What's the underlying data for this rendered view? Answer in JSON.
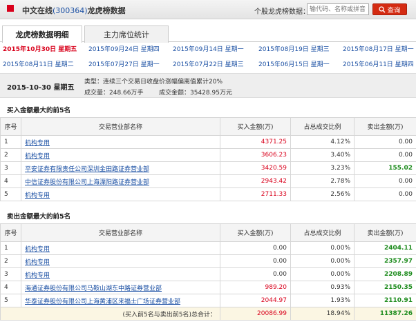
{
  "header": {
    "title_prefix": "中文在线",
    "stock_code": "(300364)",
    "title_suffix": "龙虎榜数据",
    "search_label": "个股龙虎榜数据：",
    "search_placeholder": "输代码、名称或拼音",
    "search_button": "查询"
  },
  "tabs": [
    {
      "label": "龙虎榜数据明细",
      "active": true
    },
    {
      "label": "主力席位统计",
      "active": false
    }
  ],
  "dates": [
    {
      "label": "2015年10月30日 星期五",
      "selected": true
    },
    {
      "label": "2015年09月24日 星期四",
      "selected": false
    },
    {
      "label": "2015年09月14日 星期一",
      "selected": false
    },
    {
      "label": "2015年08月19日 星期三",
      "selected": false
    },
    {
      "label": "2015年08月17日 星期一",
      "selected": false
    },
    {
      "label": "2015年08月11日 星期二",
      "selected": false
    },
    {
      "label": "2015年07月27日 星期一",
      "selected": false
    },
    {
      "label": "2015年07月22日 星期三",
      "selected": false
    },
    {
      "label": "2015年06月15日 星期一",
      "selected": false
    },
    {
      "label": "2015年06月11日 星期四",
      "selected": false
    }
  ],
  "summary": {
    "date": "2015-10-30 星期五",
    "type": "类型：连续三个交易日收盘价涨幅偏离值累计20%",
    "volume": "成交量：248.66万手",
    "amount": "成交金额：35428.95万元"
  },
  "buy_section": {
    "title": "买入金额最大的前5名",
    "headers": [
      "序号",
      "交易营业部名称",
      "买入金额(万)",
      "占总成交比例",
      "卖出金额(万)"
    ],
    "rows": [
      {
        "idx": "1",
        "name": "机构专用",
        "buy": "4371.25",
        "ratio": "4.12%",
        "sell": "0.00",
        "sell_color": "normal"
      },
      {
        "idx": "2",
        "name": "机构专用",
        "buy": "3606.23",
        "ratio": "3.40%",
        "sell": "0.00",
        "sell_color": "normal"
      },
      {
        "idx": "3",
        "name": "平安证券有限责任公司深圳金田路证券营业部",
        "buy": "3420.59",
        "ratio": "3.23%",
        "sell": "155.02",
        "sell_color": "green"
      },
      {
        "idx": "4",
        "name": "中信证券股份有限公司上海溧阳路证券营业部",
        "buy": "2943.42",
        "ratio": "2.78%",
        "sell": "0.00",
        "sell_color": "normal"
      },
      {
        "idx": "5",
        "name": "机构专用",
        "buy": "2711.33",
        "ratio": "2.56%",
        "sell": "0.00",
        "sell_color": "normal"
      }
    ]
  },
  "sell_section": {
    "title": "卖出金额最大的前5名",
    "headers": [
      "序号",
      "交易营业部名称",
      "买入金额(万)",
      "占总成交比例",
      "卖出金额(万)"
    ],
    "rows": [
      {
        "idx": "1",
        "name": "机构专用",
        "buy": "0.00",
        "buy_color": "normal",
        "ratio": "0.00%",
        "sell": "2404.11"
      },
      {
        "idx": "2",
        "name": "机构专用",
        "buy": "0.00",
        "buy_color": "normal",
        "ratio": "0.00%",
        "sell": "2357.97"
      },
      {
        "idx": "3",
        "name": "机构专用",
        "buy": "0.00",
        "buy_color": "normal",
        "ratio": "0.00%",
        "sell": "2208.89"
      },
      {
        "idx": "4",
        "name": "海通证券股份有限公司马鞍山湖东中路证券营业部",
        "buy": "989.20",
        "buy_color": "red",
        "ratio": "0.93%",
        "sell": "2150.35"
      },
      {
        "idx": "5",
        "name": "华泰证券股份有限公司上海黄浦区来福士广场证券营业部",
        "buy": "2044.97",
        "buy_color": "red",
        "ratio": "1.93%",
        "sell": "2110.91"
      }
    ],
    "totals": {
      "label": "(买入前5名与卖出前5名)总合计：",
      "buy": "20086.99",
      "ratio": "18.94%",
      "sell": "11387.26"
    }
  },
  "colors": {
    "accent_red": "#d9001b",
    "link_blue": "#1a4fa3",
    "sell_green": "#1e8c1e"
  }
}
